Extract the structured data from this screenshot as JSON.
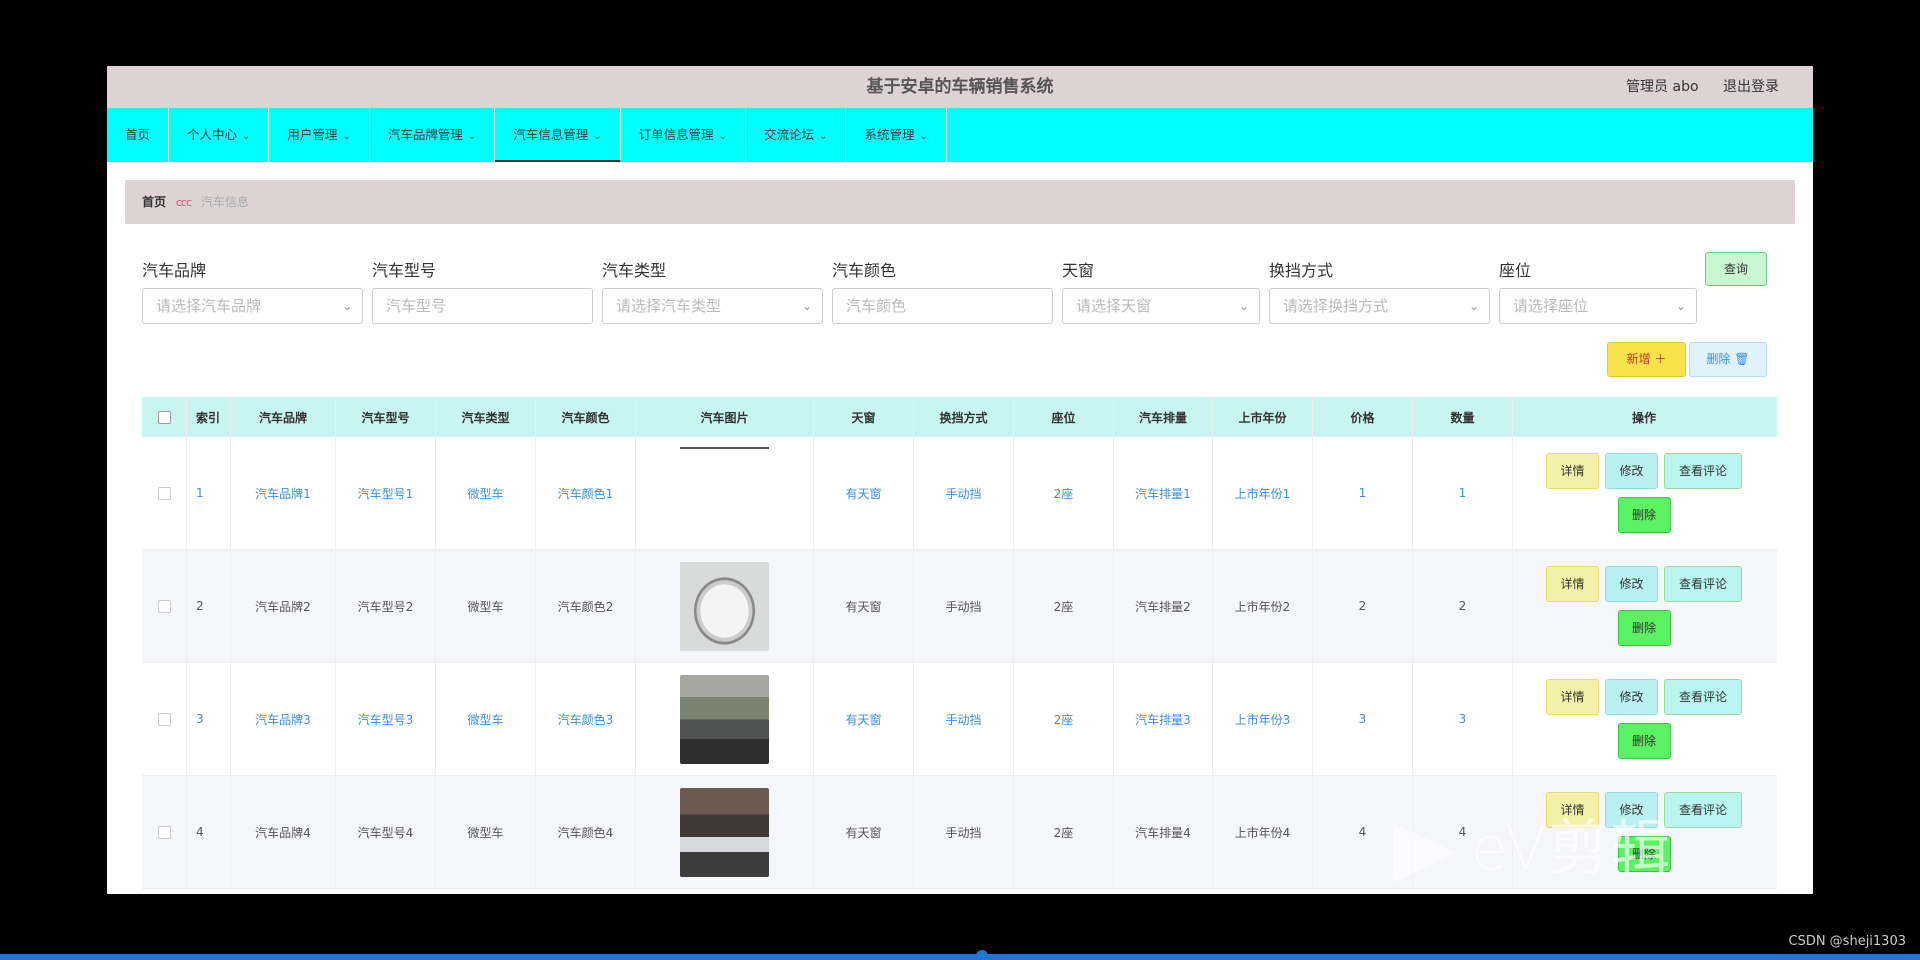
{
  "app": {
    "title": "基于安卓的车辆销售系统",
    "user_label": "管理员 abo",
    "logout_label": "退出登录"
  },
  "nav": {
    "items": [
      {
        "label": "首页",
        "has_chevron": false
      },
      {
        "label": "个人中心",
        "has_chevron": true
      },
      {
        "label": "用户管理",
        "has_chevron": true
      },
      {
        "label": "汽车品牌管理",
        "has_chevron": true
      },
      {
        "label": "汽车信息管理",
        "has_chevron": true,
        "active": true
      },
      {
        "label": "订单信息管理",
        "has_chevron": true
      },
      {
        "label": "交流论坛",
        "has_chevron": true
      },
      {
        "label": "系统管理",
        "has_chevron": true
      }
    ]
  },
  "breadcrumb": {
    "home": "首页",
    "separator": "ccc",
    "current": "汽车信息"
  },
  "filters": [
    {
      "label": "汽车品牌",
      "placeholder": "请选择汽车品牌",
      "type": "select"
    },
    {
      "label": "汽车型号",
      "placeholder": "汽车型号",
      "type": "input"
    },
    {
      "label": "汽车类型",
      "placeholder": "请选择汽车类型",
      "type": "select"
    },
    {
      "label": "汽车颜色",
      "placeholder": "汽车颜色",
      "type": "input"
    },
    {
      "label": "天窗",
      "placeholder": "请选择天窗",
      "type": "select"
    },
    {
      "label": "换挡方式",
      "placeholder": "请选择换挡方式",
      "type": "select"
    },
    {
      "label": "座位",
      "placeholder": "请选择座位",
      "type": "select"
    }
  ],
  "actions": {
    "query_label": "查询",
    "add_label": "新增 ＋",
    "delete_label": "删除 🗑"
  },
  "table": {
    "headers": [
      "",
      "索引",
      "汽车品牌",
      "汽车型号",
      "汽车类型",
      "汽车颜色",
      "汽车图片",
      "天窗",
      "换挡方式",
      "座位",
      "汽车排量",
      "上市年份",
      "价格",
      "数量",
      "操作"
    ],
    "rows": [
      {
        "index": "1",
        "brand": "汽车品牌1",
        "model": "汽车型号1",
        "type": "微型车",
        "color": "汽车颜色1",
        "sunroof": "有天窗",
        "gear": "手动挡",
        "seats": "2座",
        "displacement": "汽车排量1",
        "year": "上市年份1",
        "price": "1",
        "qty": "1"
      },
      {
        "index": "2",
        "brand": "汽车品牌2",
        "model": "汽车型号2",
        "type": "微型车",
        "color": "汽车颜色2",
        "sunroof": "有天窗",
        "gear": "手动挡",
        "seats": "2座",
        "displacement": "汽车排量2",
        "year": "上市年份2",
        "price": "2",
        "qty": "2"
      },
      {
        "index": "3",
        "brand": "汽车品牌3",
        "model": "汽车型号3",
        "type": "微型车",
        "color": "汽车颜色3",
        "sunroof": "有天窗",
        "gear": "手动挡",
        "seats": "2座",
        "displacement": "汽车排量3",
        "year": "上市年份3",
        "price": "3",
        "qty": "3"
      },
      {
        "index": "4",
        "brand": "汽车品牌4",
        "model": "汽车型号4",
        "type": "微型车",
        "color": "汽车颜色4",
        "sunroof": "有天窗",
        "gear": "手动挡",
        "seats": "2座",
        "displacement": "汽车排量4",
        "year": "上市年份4",
        "price": "4",
        "qty": "4"
      }
    ],
    "row_actions": {
      "detail": "详情",
      "edit": "修改",
      "review": "查看评论",
      "remove": "删除"
    }
  },
  "overlay": {
    "watermark": "eV剪辑",
    "credit": "CSDN @sheji1303"
  },
  "colors": {
    "nav_bg": "#00ffff",
    "header_bg": "#ddd3d5",
    "table_head_bg": "#c8f4f2",
    "link_blue": "#3a8ee6"
  }
}
